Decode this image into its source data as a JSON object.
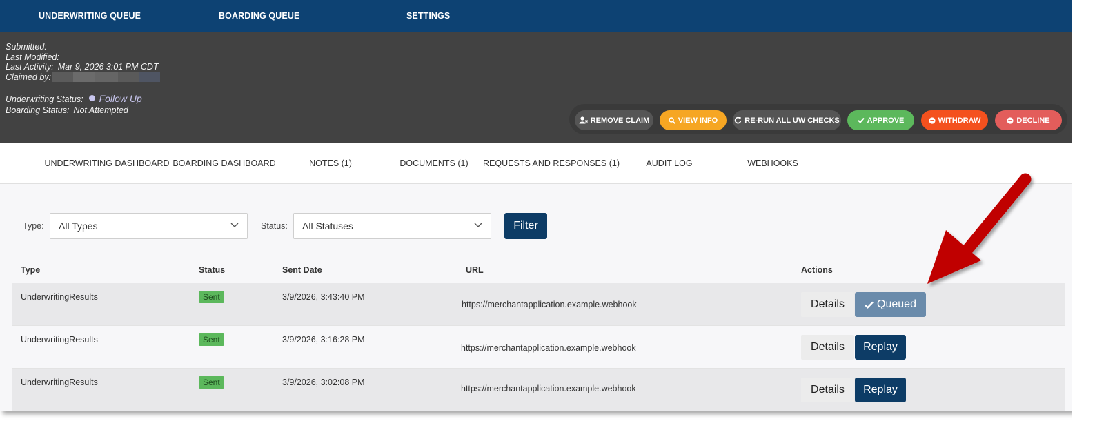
{
  "nav": {
    "underwriting_queue": "UNDERWRITING QUEUE",
    "boarding_queue": "BOARDING QUEUE",
    "settings": "SETTINGS"
  },
  "info": {
    "submitted_label": "Submitted:",
    "last_modified_label": "Last Modified:",
    "last_activity_label": "Last Activity:",
    "last_activity_value": "Mar 9, 2026 3:01 PM CDT",
    "claimed_by_label": "Claimed by:",
    "uw_status_label": "Underwriting Status:",
    "uw_status_value": "Follow Up",
    "boarding_status_label": "Boarding Status:",
    "boarding_status_value": "Not Attempted",
    "status_dot_color": "#c8c6ee"
  },
  "actions": {
    "remove_claim": "REMOVE CLAIM",
    "view_info": "VIEW INFO",
    "rerun": "RE-RUN ALL UW CHECKS",
    "approve": "APPROVE",
    "withdraw": "WITHDRAW",
    "decline": "DECLINE",
    "colors": {
      "remove_claim": "#555555",
      "view_info": "#f6a623",
      "rerun": "#555555",
      "approve": "#5cb85c",
      "withdraw": "#f4511e",
      "decline": "#e35d5b"
    }
  },
  "tabs": {
    "uw_dashboard": "UNDERWRITING DASHBOARD",
    "boarding_dashboard": "BOARDING DASHBOARD",
    "notes": "NOTES (1)",
    "documents": "DOCUMENTS (1)",
    "requests": "REQUESTS AND RESPONSES (1)",
    "audit_log": "AUDIT LOG",
    "webhooks": "WEBHOOKS",
    "active": "WEBHOOKS"
  },
  "filter": {
    "type_label": "Type:",
    "type_value": "All Types",
    "status_label": "Status:",
    "status_value": "All Statuses",
    "button": "Filter"
  },
  "table": {
    "headers": {
      "type": "Type",
      "status": "Status",
      "sent_date": "Sent Date",
      "url": "URL",
      "actions": "Actions"
    },
    "rows": [
      {
        "type": "UnderwritingResults",
        "status": "Sent",
        "sent_date": "3/9/2026, 3:43:40 PM",
        "url": "https://merchantapplication.example.webhook",
        "details": "Details",
        "action": "Queued"
      },
      {
        "type": "UnderwritingResults",
        "status": "Sent",
        "sent_date": "3/9/2026, 3:16:28 PM",
        "url": "https://merchantapplication.example.webhook",
        "details": "Details",
        "action": "Replay"
      },
      {
        "type": "UnderwritingResults",
        "status": "Sent",
        "sent_date": "3/9/2026, 3:02:08 PM",
        "url": "https://merchantapplication.example.webhook",
        "details": "Details",
        "action": "Replay"
      }
    ]
  },
  "annotation": {
    "arrow_color": "#c00000",
    "arrow_icon": "arrow-pointer-icon"
  }
}
